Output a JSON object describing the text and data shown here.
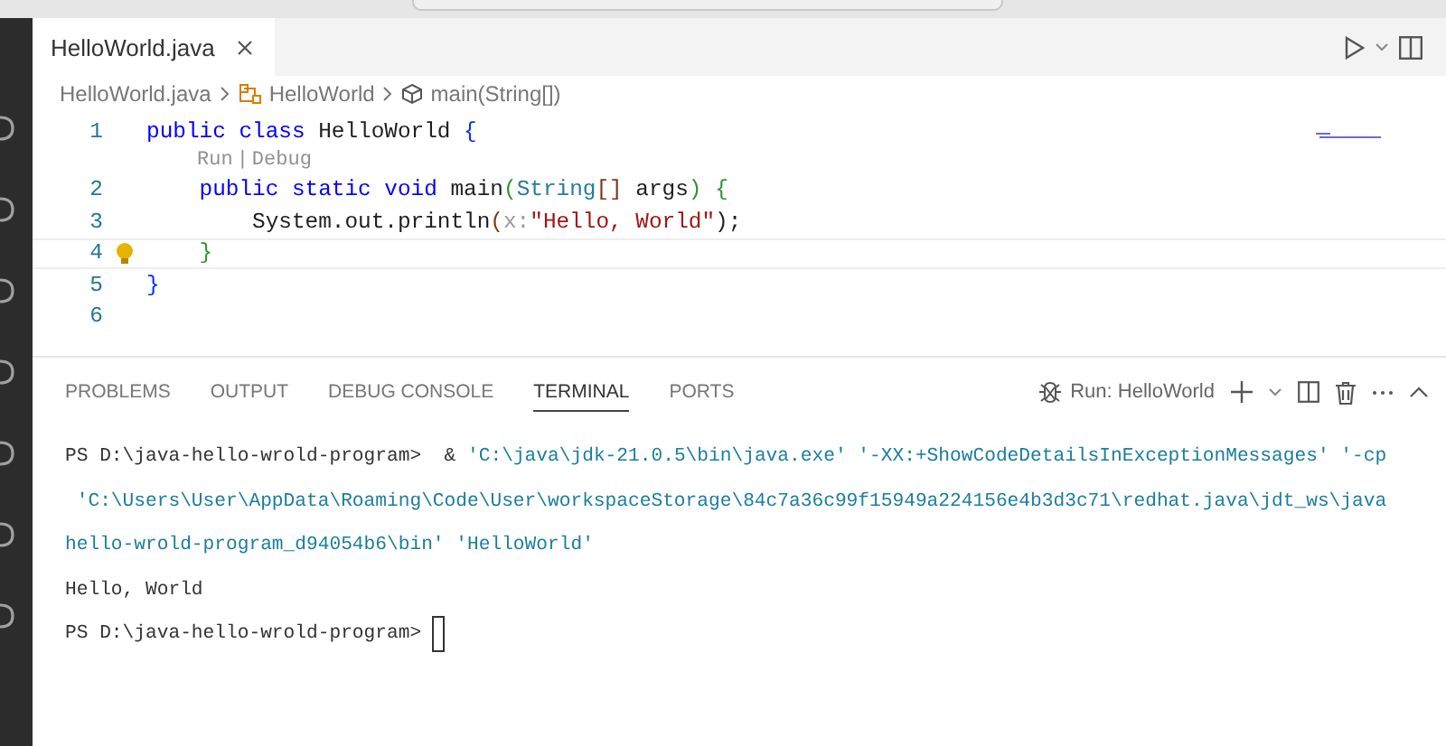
{
  "editor": {
    "tabs": [
      {
        "label": "HelloWorld.java",
        "selected": true
      }
    ],
    "breadcrumbs": [
      {
        "label": "HelloWorld.java",
        "kind": "file"
      },
      {
        "label": "HelloWorld",
        "kind": "class"
      },
      {
        "label": "main(String[])",
        "kind": "method"
      }
    ],
    "lines": [
      {
        "kind": "code",
        "number": "1",
        "current": false,
        "lightbulb": false,
        "tokens": [
          {
            "text": "public class ",
            "kind": "keyword"
          },
          {
            "text": "HelloWorld ",
            "kind": "plain"
          },
          {
            "text": "{",
            "kind": "bracket"
          }
        ]
      },
      {
        "kind": "codelens",
        "actions": [
          "Run",
          "Debug"
        ],
        "separator": "|"
      },
      {
        "kind": "code",
        "number": "2",
        "current": false,
        "lightbulb": false,
        "tokens": [
          {
            "text": "    public static void ",
            "kind": "keyword"
          },
          {
            "text": "main",
            "kind": "plain"
          },
          {
            "text": "(",
            "kind": "bracket2"
          },
          {
            "text": "String",
            "kind": "type"
          },
          {
            "text": "[]",
            "kind": "bracket3"
          },
          {
            "text": " args",
            "kind": "plain"
          },
          {
            "text": ")",
            "kind": "bracket2"
          },
          {
            "text": " {",
            "kind": "bracket2"
          }
        ]
      },
      {
        "kind": "code",
        "number": "3",
        "current": false,
        "lightbulb": false,
        "tokens": [
          {
            "text": "        System.out.println",
            "kind": "plain"
          },
          {
            "text": "(",
            "kind": "bracket3"
          },
          {
            "text": "x:",
            "kind": "hint"
          },
          {
            "text": "\"Hello, World\"",
            "kind": "string"
          },
          {
            "text": ");",
            "kind": "plain"
          }
        ]
      },
      {
        "kind": "code",
        "number": "4",
        "current": true,
        "lightbulb": true,
        "tokens": [
          {
            "text": "    }",
            "kind": "bracket2"
          }
        ]
      },
      {
        "kind": "code",
        "number": "5",
        "current": false,
        "lightbulb": false,
        "tokens": [
          {
            "text": "}",
            "kind": "bracket"
          }
        ]
      },
      {
        "kind": "code",
        "number": "6",
        "current": false,
        "lightbulb": false
      }
    ]
  },
  "panel": {
    "tabs": [
      {
        "label": "PROBLEMS",
        "selected": false
      },
      {
        "label": "OUTPUT",
        "selected": false
      },
      {
        "label": "DEBUG CONSOLE",
        "selected": false
      },
      {
        "label": "TERMINAL",
        "selected": true
      },
      {
        "label": "PORTS",
        "selected": false
      }
    ],
    "terminal_name": "Run: HelloWorld",
    "terminal_lines": [
      {
        "cursor": false,
        "tokens": [
          {
            "text": "PS D:\\java-hello-wrold-program>  & ",
            "kind": "plain"
          },
          {
            "text": "'C:\\java\\jdk-21.0.5\\bin\\java.exe' '-XX:+ShowCodeDetailsInExceptionMessages' '-cp",
            "kind": "string"
          }
        ]
      },
      {
        "cursor": false,
        "tokens": [
          {
            "text": " 'C:\\Users\\User\\AppData\\Roaming\\Code\\User\\workspaceStorage\\84c7a36c99f15949a224156e4b3d3c71\\redhat.java\\jdt_ws\\java",
            "kind": "string"
          }
        ]
      },
      {
        "cursor": false,
        "tokens": [
          {
            "text": "hello-wrold-program_d94054b6\\bin' 'HelloWorld'",
            "kind": "string"
          }
        ]
      },
      {
        "cursor": false,
        "tokens": [
          {
            "text": "Hello, World",
            "kind": "plain"
          }
        ]
      },
      {
        "cursor": true,
        "tokens": [
          {
            "text": "PS D:\\java-hello-wrold-program> ",
            "kind": "plain"
          }
        ]
      }
    ]
  }
}
